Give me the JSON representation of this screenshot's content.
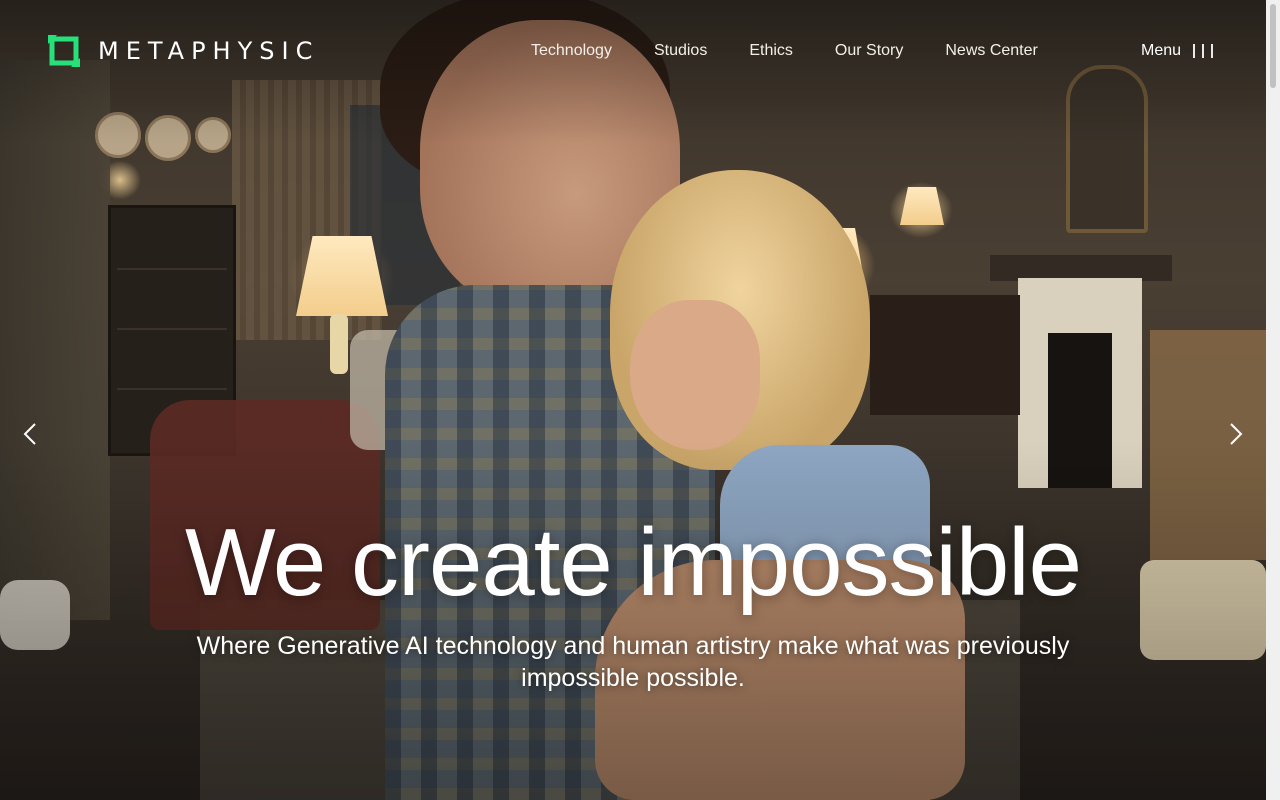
{
  "brand": {
    "name": "METAPHYSIC",
    "accent_color": "#28e07a"
  },
  "nav": {
    "items": [
      {
        "label": "Technology"
      },
      {
        "label": "Studios"
      },
      {
        "label": "Ethics"
      },
      {
        "label": "Our Story"
      },
      {
        "label": "News Center"
      }
    ],
    "menu_label": "Menu",
    "menu_icon": "three-vertical-bars-icon"
  },
  "hero": {
    "headline": "We create impossible",
    "subheadline": "Where Generative AI technology and human artistry make what was previously impossible possible.",
    "prev_icon": "chevron-left-icon",
    "next_icon": "chevron-right-icon"
  }
}
